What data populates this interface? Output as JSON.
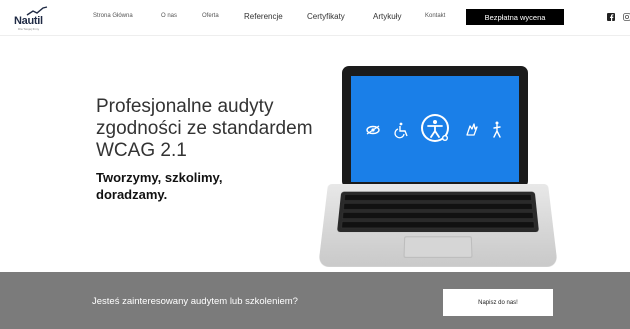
{
  "header": {
    "logo_text": "Nautil",
    "logo_tagline": "Dla Twojej firmy",
    "nav": [
      {
        "label": "Strona Główna"
      },
      {
        "label": "O nas"
      },
      {
        "label": "Oferta"
      },
      {
        "label": "Referencje"
      },
      {
        "label": "Certyfikaty"
      },
      {
        "label": "Artykuły"
      },
      {
        "label": "Kontakt"
      }
    ],
    "cta_label": "Bezpłatna wycena",
    "social": [
      "facebook-icon",
      "instagram-icon"
    ]
  },
  "hero": {
    "title": "Profesjonalne audyty zgodności ze standardem WCAG 2.1",
    "subtitle": "Tworzymy, szkolimy, doradzamy."
  },
  "banner": {
    "text": "Jesteś zainteresowany audytem lub szkoleniem?",
    "button_label": "Napisz do nas!"
  },
  "colors": {
    "screen_blue": "#1a7fe8",
    "banner_gray": "#7b7b7b",
    "cta_black": "#000000"
  }
}
